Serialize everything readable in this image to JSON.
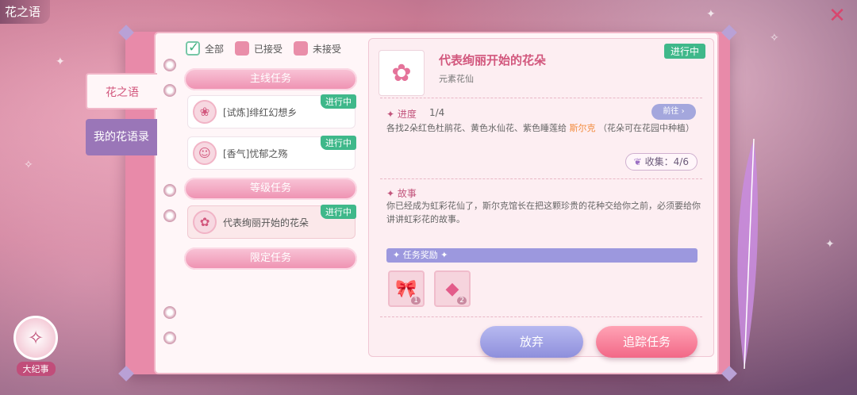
{
  "app_title": "花之语",
  "filters": [
    {
      "label": "全部",
      "checked": true
    },
    {
      "label": "已接受",
      "checked": false
    },
    {
      "label": "未接受",
      "checked": false
    }
  ],
  "side_tabs": {
    "active": "花之语",
    "inactive": "我的花语录"
  },
  "sections": {
    "main": "主线任务",
    "level": "等级任务",
    "limited": "限定任务"
  },
  "tasks": [
    {
      "name": "[试炼]绯红幻想乡",
      "status": "进行中"
    },
    {
      "name": "[香气]忧郁之殇",
      "status": "进行中"
    },
    {
      "name": "代表绚丽开始的花朵",
      "status": "进行中"
    }
  ],
  "detail": {
    "title": "代表绚丽开始的花朵",
    "subtitle": "元素花仙",
    "status": "进行中",
    "progress_label": "进度",
    "progress_value": "1/4",
    "goto_label": "前往",
    "progress_desc_a": "各找2朵红色杜鹃花、黄色水仙花、紫色睡莲给 ",
    "progress_desc_highlight": "斯尔克",
    "progress_desc_b": " （花朵可在花园中种植）",
    "collect_label": "收集：4/6",
    "story_label": "故事",
    "story_text": "你已经成为虹彩花仙了，斯尔克馆长在把这颗珍贵的花种交给你之前，必须要给你讲讲虹彩花的故事。",
    "reward_label": "任务奖励",
    "rewards": [
      {
        "icon": "bell-bow-icon",
        "count": "1"
      },
      {
        "icon": "gem-icon",
        "count": "2"
      }
    ],
    "abandon_label": "放弃",
    "track_label": "追踪任务"
  },
  "chronicle_label": "大纪事",
  "colors": {
    "accent_pink": "#d2577d",
    "status_green": "#3fb88a",
    "button_purple": "#8e8fdc",
    "button_pink": "#f26887"
  }
}
